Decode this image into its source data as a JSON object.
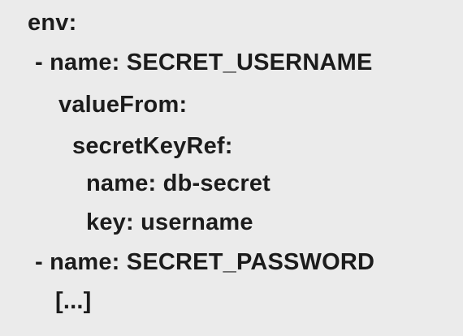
{
  "code": {
    "lines": [
      "env:",
      "- name: SECRET_USERNAME",
      "valueFrom:",
      "secretKeyRef:",
      "name: db-secret",
      "key: username",
      "- name: SECRET_PASSWORD",
      "[...]"
    ]
  }
}
